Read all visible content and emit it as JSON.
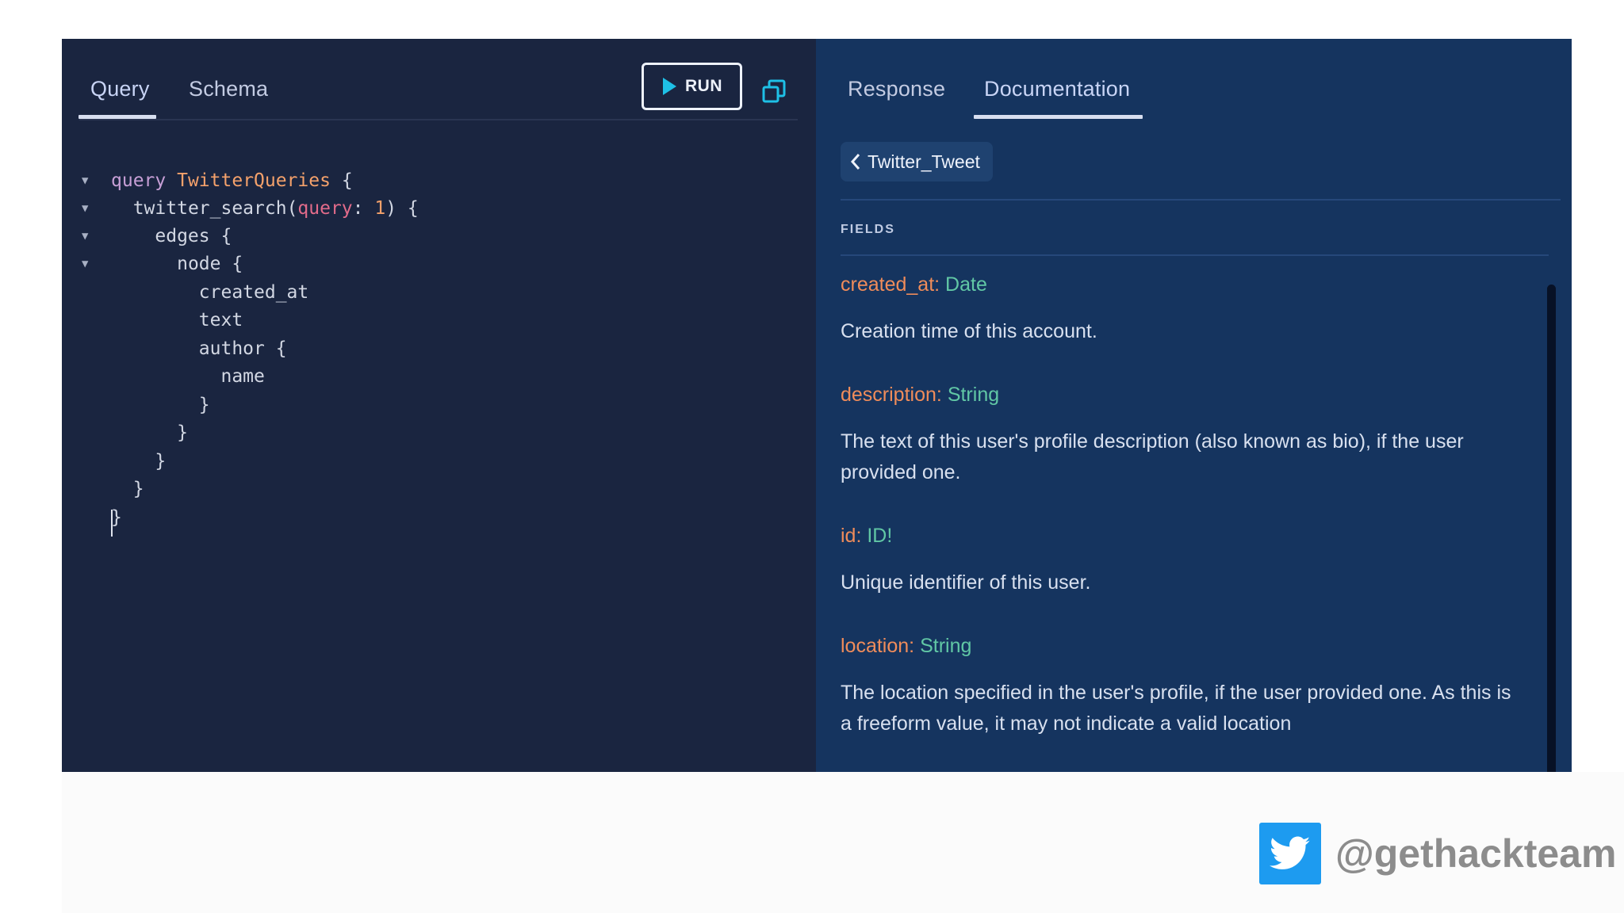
{
  "colors": {
    "left_bg": "#1a2540",
    "right_bg": "#15345f",
    "field_name": "#f08c5a",
    "field_type": "#61c7a5",
    "brand_twitter": "#1d9bf0"
  },
  "query_pane": {
    "tabs": [
      {
        "label": "Query",
        "active": true
      },
      {
        "label": "Schema",
        "active": false
      }
    ],
    "run_label": "RUN",
    "icons": {
      "run": "play-icon",
      "copy": "copy-icon"
    },
    "code": {
      "lines": [
        {
          "indent": "",
          "parts": [
            "query",
            " ",
            "TwitterQueries",
            " {"
          ],
          "fold": true
        },
        {
          "indent": "  ",
          "parts": [
            "twitter_search(",
            "query",
            ": ",
            "1",
            ") {"
          ],
          "fold": true
        },
        {
          "indent": "    ",
          "parts": [
            "edges {"
          ],
          "fold": true
        },
        {
          "indent": "      ",
          "parts": [
            "node {"
          ],
          "fold": true
        },
        {
          "indent": "        ",
          "parts": [
            "created_at"
          ],
          "fold": false
        },
        {
          "indent": "        ",
          "parts": [
            "text"
          ],
          "fold": false
        },
        {
          "indent": "        ",
          "parts": [
            "author {"
          ],
          "fold": false
        },
        {
          "indent": "          ",
          "parts": [
            "name"
          ],
          "fold": false
        },
        {
          "indent": "        ",
          "parts": [
            "}"
          ],
          "fold": false
        },
        {
          "indent": "      ",
          "parts": [
            "}"
          ],
          "fold": false
        },
        {
          "indent": "    ",
          "parts": [
            "}"
          ],
          "fold": false
        },
        {
          "indent": "  ",
          "parts": [
            "}"
          ],
          "fold": false
        },
        {
          "indent": "",
          "parts": [
            "}"
          ],
          "fold": false
        }
      ]
    }
  },
  "doc_pane": {
    "tabs": [
      {
        "label": "Response",
        "active": false
      },
      {
        "label": "Documentation",
        "active": true
      }
    ],
    "back_label": "Twitter_Tweet",
    "fields_heading": "FIELDS",
    "fields": [
      {
        "name": "created_at:",
        "type": "Date",
        "description": "Creation time of this account."
      },
      {
        "name": "description:",
        "type": "String",
        "description": "The text of this user's profile description (also known as bio), if the user provided one."
      },
      {
        "name": "id:",
        "type": "ID!",
        "description": "Unique identifier of this user."
      },
      {
        "name": "location:",
        "type": "String",
        "description": "The location specified in the user's profile, if the user provided one. As this is a freeform value, it may not indicate a valid location"
      }
    ]
  },
  "watermark": {
    "handle": "@gethackteam",
    "icon": "twitter-bird-icon"
  }
}
